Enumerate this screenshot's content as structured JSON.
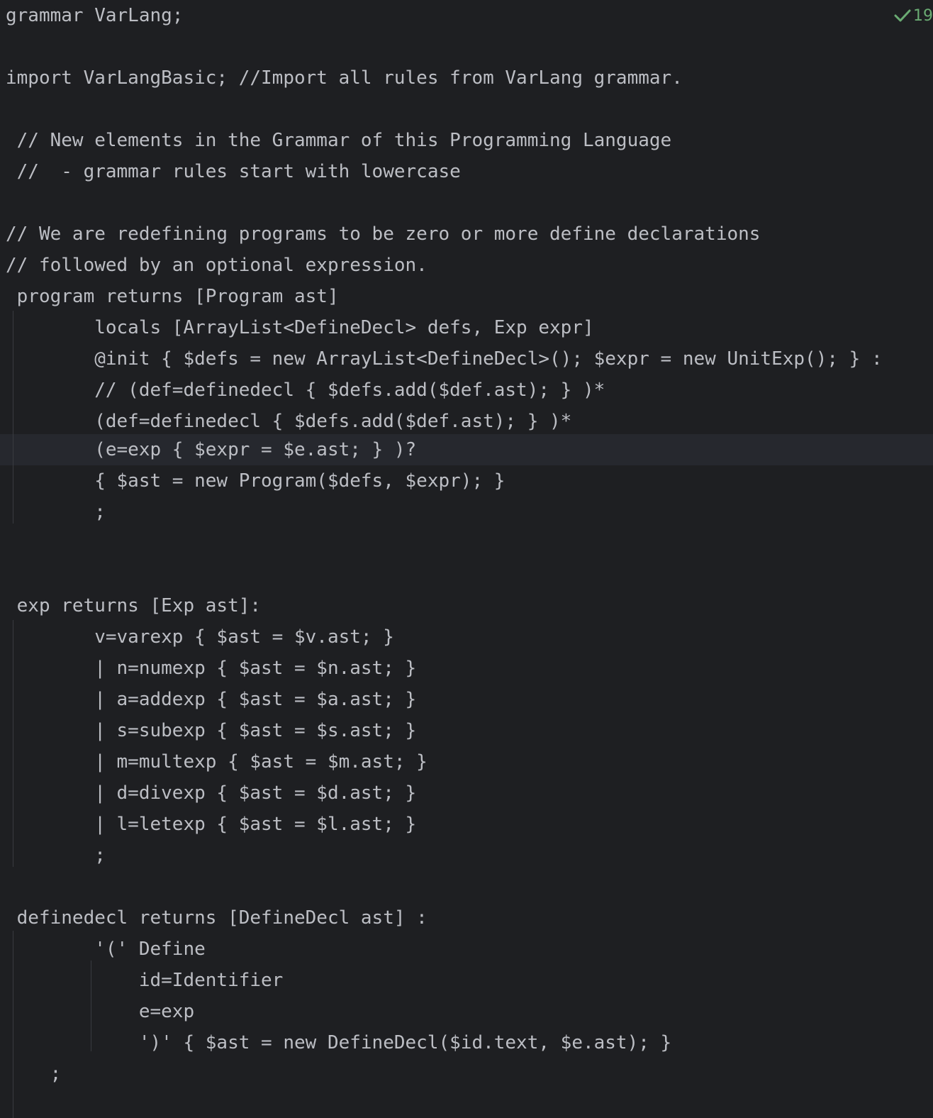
{
  "editor": {
    "status": {
      "check_icon": "check-icon",
      "count": "19",
      "accent": "#6aab73"
    },
    "lines": [
      "grammar VarLang;",
      "",
      "import VarLangBasic; //Import all rules from VarLang grammar.",
      "",
      " // New elements in the Grammar of this Programming Language",
      " //  - grammar rules start with lowercase",
      "",
      "// We are redefining programs to be zero or more define declarations",
      "// followed by an optional expression.",
      " program returns [Program ast]",
      "        locals [ArrayList<DefineDecl> defs, Exp expr]",
      "        @init { $defs = new ArrayList<DefineDecl>(); $expr = new UnitExp(); } :",
      "        // (def=definedecl { $defs.add($def.ast); } )*",
      "        (def=definedecl { $defs.add($def.ast); } )*",
      "        (e=exp { $expr = $e.ast; } )?",
      "        { $ast = new Program($defs, $expr); }",
      "        ;",
      "",
      "",
      " exp returns [Exp ast]:",
      "        v=varexp { $ast = $v.ast; }",
      "        | n=numexp { $ast = $n.ast; }",
      "        | a=addexp { $ast = $a.ast; }",
      "        | s=subexp { $ast = $s.ast; }",
      "        | m=multexp { $ast = $m.ast; }",
      "        | d=divexp { $ast = $d.ast; }",
      "        | l=letexp { $ast = $l.ast; }",
      "        ;",
      "",
      " definedecl returns [DefineDecl ast] :",
      "        '(' Define",
      "            id=Identifier",
      "            e=exp",
      "            ')' { $ast = new DefineDecl($id.text, $e.ast); }",
      "    ;"
    ]
  }
}
